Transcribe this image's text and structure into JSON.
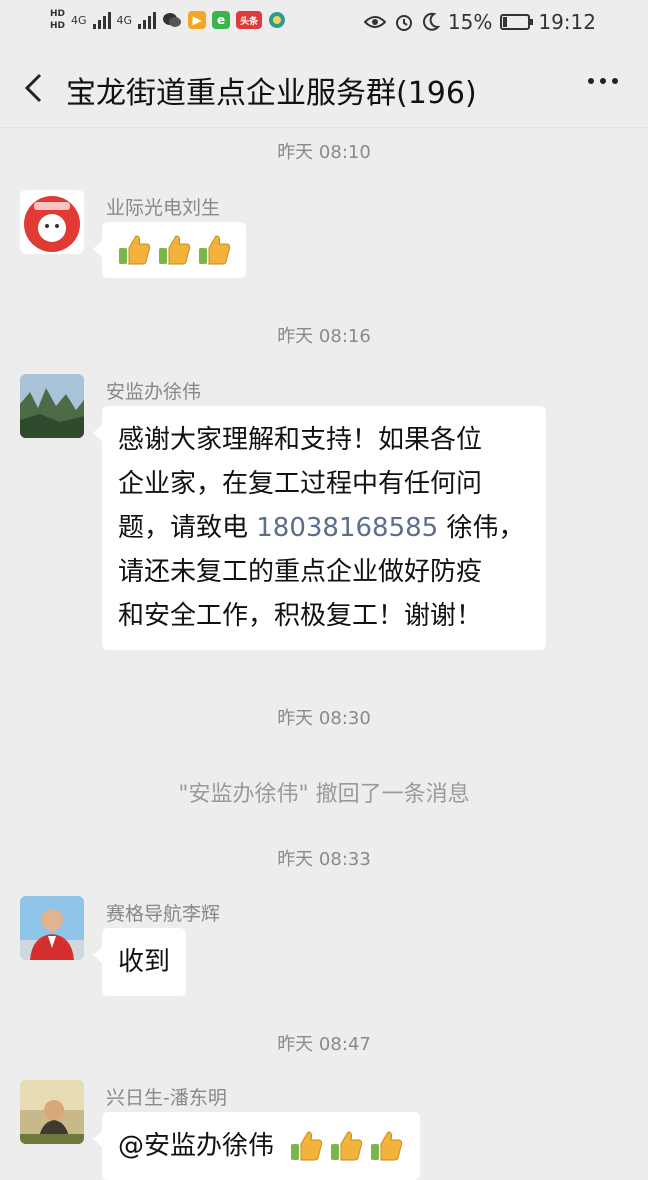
{
  "status_bar": {
    "hd1": "HD",
    "hd2": "HD",
    "net1": "4G",
    "net2": "4G",
    "battery_text": "15%",
    "battery_level": 0.15,
    "time": "19:12"
  },
  "header": {
    "title": "宝龙街道重点企业服务群(196)"
  },
  "chat": {
    "ts1": "昨天 08:10",
    "sender1": "业际光电刘生",
    "ts2": "昨天 08:16",
    "sender2": "安监办徐伟",
    "msg2_line1": "感谢大家理解和支持！如果各位",
    "msg2_line2": "企业家，在复工过程中有任何问",
    "msg2_line3_a": "题，请致电 ",
    "msg2_phone": "18038168585",
    "msg2_line3_b": " 徐伟，",
    "msg2_line4": "请还未复工的重点企业做好防疫",
    "msg2_line5": "和安全工作，积极复工！谢谢！",
    "ts3": "昨天 08:30",
    "recall": "\"安监办徐伟\" 撤回了一条消息",
    "ts4": "昨天 08:33",
    "sender3": "赛格导航李辉",
    "msg3": "收到",
    "ts5": "昨天 08:47",
    "sender4": "兴日生-潘东明",
    "msg4": "@安监办徐伟"
  },
  "icons": {
    "back": "chevron-left-icon",
    "more": "more-dots-icon",
    "thumbs": "thumbs-up-icon"
  },
  "colors": {
    "background": "#ededed",
    "bubble": "#ffffff",
    "phone_link": "#5b6e8c",
    "timestamp": "#8a8a8a"
  }
}
